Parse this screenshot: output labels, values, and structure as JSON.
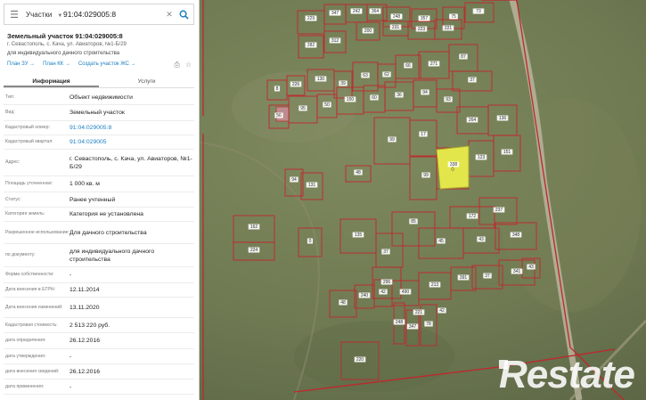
{
  "search": {
    "type_label": "Участки",
    "query": "91:04:029005:8"
  },
  "object": {
    "title": "Земельный участок 91:04:029005:8",
    "address_short": "г. Севастополь, с. Кача, ул. Авиаторов, №1-Б/29",
    "purpose_short": "для индивидуального дачного строительства"
  },
  "links": {
    "plan_zu": "План ЗУ →",
    "plan_kk": "План КК →",
    "create_ks": "Создать участок ЖС →"
  },
  "tabs": [
    {
      "label": "Информация"
    },
    {
      "label": "Услуги"
    }
  ],
  "info_rows": [
    {
      "label": "Тип:",
      "value": "Объект недвижимости"
    },
    {
      "label": "Вид:",
      "value": "Земельный участок"
    },
    {
      "label": "Кадастровый номер:",
      "value": "91:04:029005:8"
    },
    {
      "label": "Кадастровый квартал:",
      "value": "91:04:029005"
    },
    {
      "label": "Адрес:",
      "value": "г. Севастополь, с. Кача, ул. Авиаторов, №1-Б/29"
    },
    {
      "label": "Площадь уточненная:",
      "value": "1 000 кв. м"
    },
    {
      "label": "Статус:",
      "value": "Ранее учтенный"
    },
    {
      "label": "Категория земель:",
      "value": "Категория не установлена"
    },
    {
      "label": "Разрешенное использование:",
      "value": "Для дачного строительства"
    },
    {
      "label": "по документу:",
      "value": "для индивидуального дачного строительства"
    },
    {
      "label": "Форма собственности:",
      "value": "-"
    },
    {
      "label": "Дата внесения в ЕГРН:",
      "value": "12.11.2014"
    },
    {
      "label": "Дата внесения изменений:",
      "value": "13.11.2020"
    },
    {
      "label": "Кадастровая стоимость:",
      "value": "2 513 220 руб."
    },
    {
      "label": "дата определения:",
      "value": "26.12.2016"
    },
    {
      "label": "дата утверждения:",
      "value": "-"
    },
    {
      "label": "дата внесения сведений:",
      "value": "26.12.2016"
    },
    {
      "label": "дата применения:",
      "value": "-"
    }
  ],
  "map_labels": [
    "376",
    "176",
    "408",
    "206",
    "380",
    "402",
    "37",
    "347",
    "413",
    "312",
    "200",
    "231",
    "223",
    "221",
    "8",
    "226",
    "130",
    "39",
    "63",
    "62",
    "66",
    "271",
    "87",
    "37",
    "56",
    "95",
    "50",
    "150",
    "60",
    "36",
    "94",
    "93",
    "99",
    "17",
    "264",
    "136",
    "99",
    "338",
    "123",
    "151",
    "94",
    "131",
    "48",
    "162",
    "224",
    "0",
    "135",
    "37",
    "85",
    "45",
    "172",
    "237",
    "43",
    "348",
    "296",
    "490",
    "213",
    "391",
    "37",
    "341",
    "43",
    "48",
    "240",
    "42",
    "248",
    "347",
    "78",
    "220",
    "221",
    "42",
    "229",
    "347",
    "242",
    "364",
    "248",
    "357",
    "75",
    "73",
    "282"
  ],
  "selected_label": "0",
  "watermark": "Restate",
  "colors": {
    "accent": "#1a7fc1",
    "parcel_border": "#c0272d",
    "selected_fill": "#e3e64a"
  }
}
